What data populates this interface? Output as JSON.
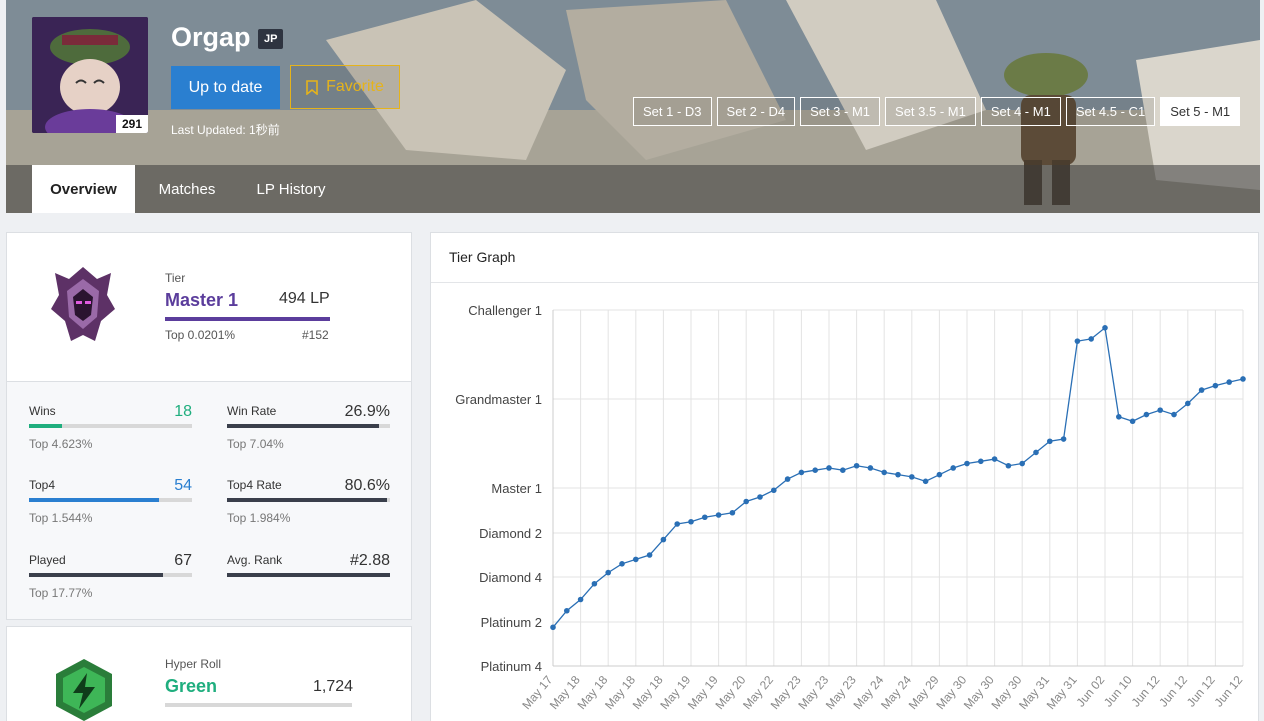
{
  "header": {
    "summoner_name": "Orgap",
    "region": "JP",
    "level": "291",
    "update_label": "Up to date",
    "favorite_label": "Favorite",
    "last_updated": "Last Updated: 1秒前",
    "sets": [
      "Set 1 - D3",
      "Set 2 - D4",
      "Set 3 - M1",
      "Set 3.5 - M1",
      "Set 4 - M1",
      "Set 4.5 - C1",
      "Set 5 - M1"
    ],
    "active_set": "Set 5 - M1",
    "tabs": [
      "Overview",
      "Matches",
      "LP History"
    ],
    "active_tab": "Overview"
  },
  "ranked": {
    "tier_label": "Tier",
    "tier": "Master 1",
    "lp": "494 LP",
    "top_percent": "Top 0.0201%",
    "rank": "#152"
  },
  "stats": [
    {
      "label": "Wins",
      "value": "18",
      "sub": "Top 4.623%",
      "fill": 0.2,
      "color": "#1fae7e"
    },
    {
      "label": "Win Rate",
      "value": "26.9%",
      "sub": "Top 7.04%",
      "fill": 0.93,
      "color": "#3a3f4b"
    },
    {
      "label": "Top4",
      "value": "54",
      "sub": "Top 1.544%",
      "fill": 0.8,
      "color": "#2a7fd0"
    },
    {
      "label": "Top4 Rate",
      "value": "80.6%",
      "sub": "Top 1.984%",
      "fill": 0.98,
      "color": "#3a3f4b"
    },
    {
      "label": "Played",
      "value": "67",
      "sub": "Top 17.77%",
      "fill": 0.82,
      "color": "#3a3f4b"
    },
    {
      "label": "Avg. Rank",
      "value": "#2.88",
      "sub": "",
      "fill": 1.0,
      "color": "#3a3f4b"
    }
  ],
  "hyper_roll": {
    "label": "Hyper Roll",
    "tier": "Green",
    "rating": "1,724"
  },
  "chart_title": "Tier Graph",
  "chart_data": {
    "type": "line",
    "title": "Tier Graph",
    "y_ticks": [
      "Platinum 4",
      "Platinum 2",
      "Diamond 4",
      "Diamond 2",
      "Master 1",
      "Grandmaster 1",
      "Challenger 1"
    ],
    "x_ticks": [
      "May 17",
      "May 18",
      "May 18",
      "May 18",
      "May 18",
      "May 19",
      "May 19",
      "May 20",
      "May 22",
      "May 23",
      "May 23",
      "May 23",
      "May 24",
      "May 24",
      "May 29",
      "May 30",
      "May 30",
      "May 30",
      "May 31",
      "May 31",
      "Jun 02",
      "Jun 10",
      "Jun 12",
      "Jun 12",
      "Jun 12",
      "Jun 12"
    ],
    "series": [
      {
        "color": "#2a6fb5",
        "values": [
          0.88,
          1.25,
          1.5,
          1.85,
          2.1,
          2.3,
          2.4,
          2.5,
          2.85,
          3.2,
          3.25,
          3.35,
          3.4,
          3.45,
          3.7,
          3.8,
          3.95,
          4.2,
          4.35,
          4.4,
          4.45,
          4.4,
          4.5,
          4.45,
          4.35,
          4.3,
          4.25,
          4.15,
          4.3,
          4.45,
          4.55,
          4.6,
          4.65,
          4.5,
          4.55,
          4.8,
          5.05,
          5.1,
          7.3,
          7.35,
          7.6,
          5.6,
          5.5,
          5.65,
          5.75,
          5.65,
          5.9,
          6.2,
          6.3,
          6.38,
          6.45
        ]
      }
    ],
    "grid": true
  }
}
